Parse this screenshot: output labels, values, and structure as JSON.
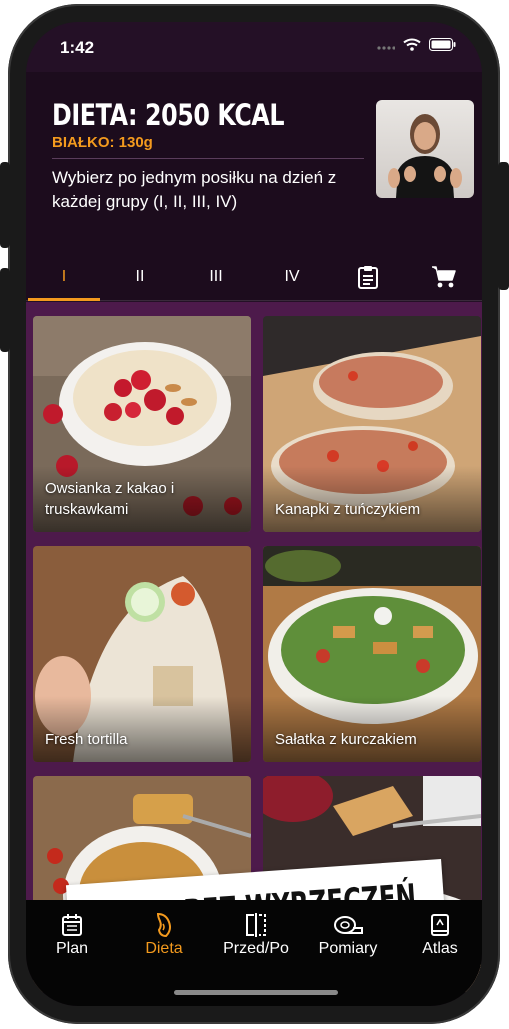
{
  "status": {
    "time": "1:42"
  },
  "header": {
    "title": "DIETA: 2050 KCAL",
    "protein": "BIAŁKO: 130g",
    "subtitle": "Wybierz po jednym posiłku na dzień z każdej grupy (I, II, III, IV)"
  },
  "tabs": [
    {
      "label": "I"
    },
    {
      "label": "II"
    },
    {
      "label": "III"
    },
    {
      "label": "IV"
    },
    {
      "icon": "clipboard-icon"
    },
    {
      "icon": "cart-icon"
    }
  ],
  "meals": [
    {
      "name": "Owsianka z kakao i truskawkami"
    },
    {
      "name": "Kanapki z tuńczykiem"
    },
    {
      "name": "Fresh tortilla"
    },
    {
      "name": "Sałatka z kurczakiem"
    },
    {
      "name": ""
    },
    {
      "name": ""
    }
  ],
  "banner": {
    "text": "DIETA BEZ WYRZECZEŃ"
  },
  "nav": [
    {
      "label": "Plan",
      "icon": "calendar-icon"
    },
    {
      "label": "Dieta",
      "icon": "food-icon"
    },
    {
      "label": "Przed/Po",
      "icon": "compare-icon"
    },
    {
      "label": "Pomiary",
      "icon": "measure-tape-icon"
    },
    {
      "label": "Atlas",
      "icon": "atlas-icon"
    }
  ],
  "colors": {
    "accent": "#f39a1e",
    "background": "#241026",
    "grid": "#4d1a4b",
    "nav": "#050505"
  }
}
